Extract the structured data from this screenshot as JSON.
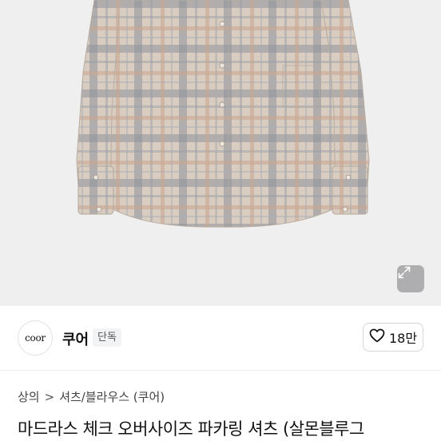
{
  "brand": {
    "logo_text": "coor",
    "name": "쿠어",
    "badge": "단독"
  },
  "likes": {
    "count": "18만"
  },
  "breadcrumb": {
    "category": "상의",
    "separator": ">",
    "subcategory": "셔츠/블라우스 (쿠어)"
  },
  "product": {
    "title": "마드라스 체크 오버사이즈 파카링 셔츠 (살몬블루그"
  },
  "icons": {
    "expand": "expand-icon",
    "heart": "heart-icon"
  },
  "colors": {
    "image_background": "#efeff0",
    "shirt_base": "#d6c8bb",
    "check_gray": "#8b9097",
    "check_salmon": "#c7a48f"
  }
}
